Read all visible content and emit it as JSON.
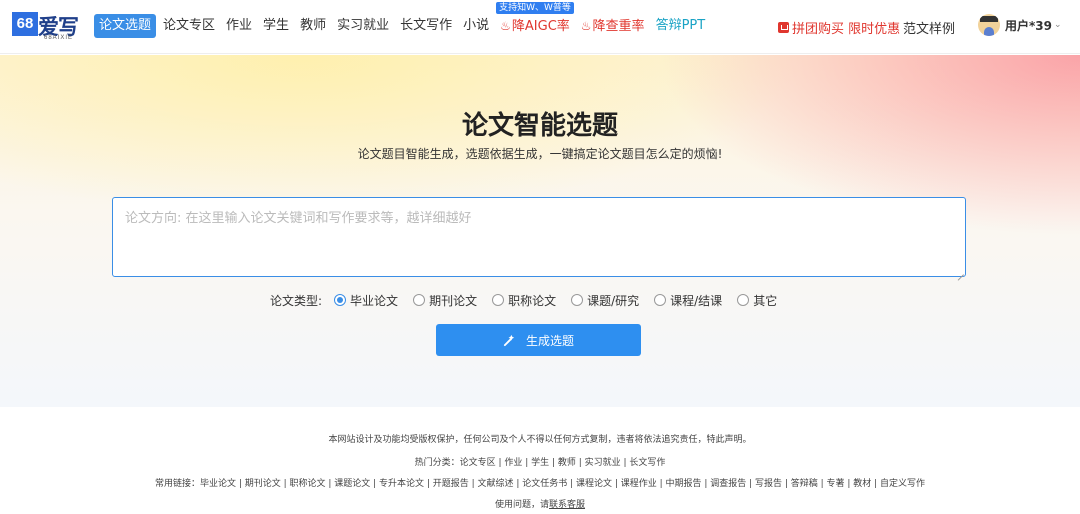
{
  "logo": {
    "box": "68",
    "text": "爱写",
    "sub": "68AIXIE"
  },
  "nav": {
    "items": [
      {
        "label": "论文选题"
      },
      {
        "label": "论文专区"
      },
      {
        "label": "作业"
      },
      {
        "label": "学生"
      },
      {
        "label": "教师"
      },
      {
        "label": "实习就业"
      },
      {
        "label": "长文写作"
      },
      {
        "label": "小说"
      }
    ],
    "aigc_badge": "支持知W、W普等",
    "aigc": "降AIGC率",
    "recheck": "降查重率",
    "ppt": "答辩PPT",
    "promo": "拼团购买 限时优惠",
    "sample": "范文样例",
    "user": "用户*39"
  },
  "hero": {
    "title": "论文智能选题",
    "subtitle": "论文题目智能生成，选题依据生成，一键搞定论文题目怎么定的烦恼!",
    "placeholder": "论文方向: 在这里输入论文关键词和写作要求等，越详细越好",
    "type_label": "论文类型:",
    "types": [
      "毕业论文",
      "期刊论文",
      "职称论文",
      "课题/研究",
      "课程/结课",
      "其它"
    ],
    "selected_type": "毕业论文",
    "button": "生成选题"
  },
  "footer": {
    "copyright": "本网站设计及功能均受版权保护，任何公司及个人不得以任何方式复制，违者将依法追究责任，特此声明。",
    "hot_label": "热门分类：",
    "hot": "论文专区 | 作业 | 学生 | 教师 | 实习就业 | 长文写作",
    "links_label": "常用链接：",
    "links": "毕业论文 | 期刊论文 | 职称论文 | 课题论文 | 专升本论文 | 开题报告 | 文献综述 | 论文任务书 | 课程论文 | 课程作业 | 中期报告 | 调查报告 | 写报告 | 答辩稿 | 专著 | 教材 | 自定义写作",
    "help_prefix": "使用问题，请",
    "help_link": "联系客服"
  },
  "colors": {
    "accent": "#2e8ff0",
    "hot": "#e0362e",
    "teal": "#1aa3c5"
  }
}
